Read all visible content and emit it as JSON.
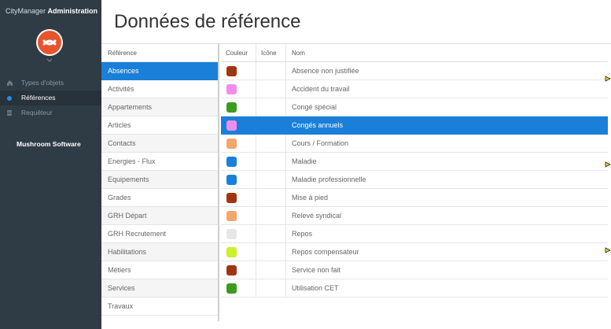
{
  "sidebar": {
    "app_name": "CityManager",
    "app_suffix": "Administration",
    "logo_color": "#e8542c",
    "nav": [
      {
        "label": "Types d'objets",
        "icon": "home-icon",
        "active": false
      },
      {
        "label": "Références",
        "icon": "dot-icon",
        "active": true
      },
      {
        "label": "Requêteur",
        "icon": "database-icon",
        "active": false
      }
    ],
    "company": "Mushroom Software"
  },
  "main": {
    "title": "Données de référence"
  },
  "references": {
    "header": "Référence",
    "items": [
      {
        "label": "Absences",
        "selected": true
      },
      {
        "label": "Activités",
        "selected": false
      },
      {
        "label": "Appartements",
        "selected": false
      },
      {
        "label": "Articles",
        "selected": false
      },
      {
        "label": "Contacts",
        "selected": false
      },
      {
        "label": "Energies - Flux",
        "selected": false
      },
      {
        "label": "Equipements",
        "selected": false
      },
      {
        "label": "Grades",
        "selected": false
      },
      {
        "label": "GRH Départ",
        "selected": false
      },
      {
        "label": "GRH Recrutement",
        "selected": false
      },
      {
        "label": "Habilitations",
        "selected": false
      },
      {
        "label": "Métiers",
        "selected": false
      },
      {
        "label": "Services",
        "selected": false
      },
      {
        "label": "Travaux",
        "selected": false
      }
    ]
  },
  "table": {
    "headers": {
      "couleur": "Couleur",
      "icone": "Icône",
      "nom": "Nom"
    },
    "rows": [
      {
        "nom": "Absence non justifiée",
        "color": "#a0360f",
        "selected": false
      },
      {
        "nom": "Accident du travail",
        "color": "#f08cf0",
        "selected": false
      },
      {
        "nom": "Congé spécial",
        "color": "#3c9a1e",
        "selected": false
      },
      {
        "nom": "Congés annuels",
        "color": "#f08cf0",
        "selected": true
      },
      {
        "nom": "Cours / Formation",
        "color": "#f5a66b",
        "selected": false
      },
      {
        "nom": "Maladie",
        "color": "#1a7fd8",
        "selected": false
      },
      {
        "nom": "Maladie professionnelle",
        "color": "#1a7fd8",
        "selected": false
      },
      {
        "nom": "Mise à pied",
        "color": "#a0360f",
        "selected": false
      },
      {
        "nom": "Relevé syndical",
        "color": "#f5a66b",
        "selected": false
      },
      {
        "nom": "Repos",
        "color": "#e6e6e6",
        "selected": false
      },
      {
        "nom": "Repos compensateur",
        "color": "#ccf02a",
        "selected": false
      },
      {
        "nom": "Service non fait",
        "color": "#a0360f",
        "selected": false
      },
      {
        "nom": "Utilisation CET",
        "color": "#3c9a1e",
        "selected": false
      }
    ]
  }
}
